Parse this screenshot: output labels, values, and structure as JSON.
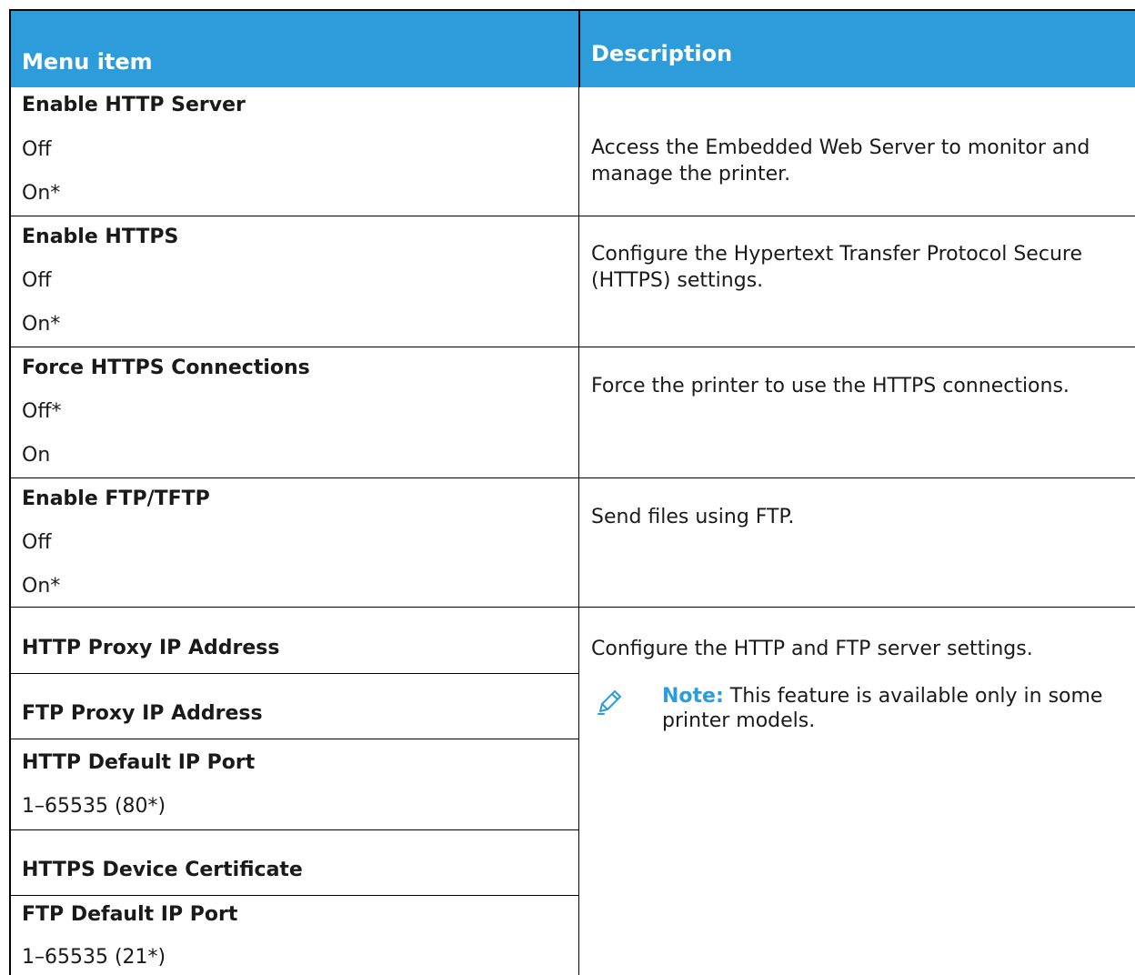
{
  "header": {
    "menu_item": "Menu item",
    "description": "Description"
  },
  "rows": [
    {
      "title": "Enable HTTP Server",
      "options": [
        "Off",
        "On*"
      ],
      "description": "Access the Embedded Web Server to monitor and manage the printer."
    },
    {
      "title": "Enable HTTPS",
      "options": [
        "Off",
        "On*"
      ],
      "description": "Configure the Hypertext Transfer Protocol Secure (HTTPS) settings."
    },
    {
      "title": "Force HTTPS Connections",
      "options": [
        "Off*",
        "On"
      ],
      "description": "Force the printer to use the HTTPS connections."
    },
    {
      "title": "Enable FTP/TFTP",
      "options": [
        "Off",
        "On*"
      ],
      "description": "Send files using FTP."
    }
  ],
  "group": {
    "items": [
      {
        "title": "HTTP Proxy IP Address"
      },
      {
        "title": "FTP Proxy IP Address"
      },
      {
        "title": "HTTP Default IP Port",
        "value": "1–65535 (80*)"
      },
      {
        "title": "HTTPS Device Certificate"
      },
      {
        "title": "FTP Default IP Port",
        "value": "1–65535 (21*)"
      }
    ],
    "description": "Configure the HTTP and FTP server settings.",
    "note_label": "Note:",
    "note_text": " This feature is available only in some printer models.",
    "note_icon": "pencil-icon"
  },
  "colors": {
    "header_bg": "#2d9cdb",
    "note_label": "#2d9cdb"
  }
}
